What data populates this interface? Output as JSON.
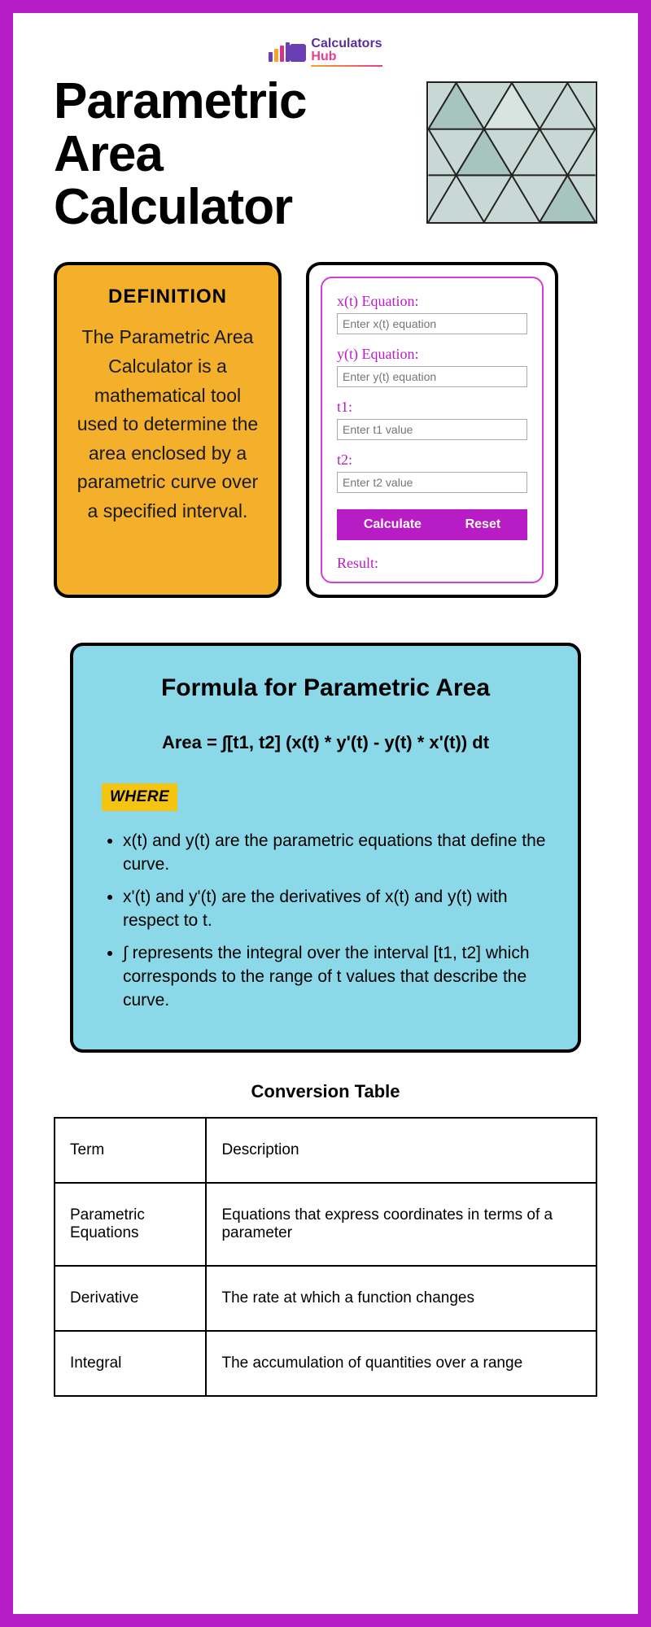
{
  "logo": {
    "line1": "Calculators",
    "line2": "Hub"
  },
  "title": "Parametric\nArea\nCalculator",
  "definition": {
    "heading": "DEFINITION",
    "body": "The Parametric Area Calculator is a mathematical tool used to determine the area enclosed by a parametric curve over a specified interval."
  },
  "calculator": {
    "xt_label": "x(t) Equation:",
    "xt_placeholder": "Enter x(t) equation",
    "yt_label": "y(t) Equation:",
    "yt_placeholder": "Enter y(t) equation",
    "t1_label": "t1:",
    "t1_placeholder": "Enter t1 value",
    "t2_label": "t2:",
    "t2_placeholder": "Enter t2 value",
    "calculate": "Calculate",
    "reset": "Reset",
    "result_label": "Result:"
  },
  "formula": {
    "heading": "Formula for Parametric Area",
    "expression": "Area = ∫[t1, t2] (x(t) * y'(t) - y(t) * x'(t)) dt",
    "where_tag": "WHERE",
    "bullets": [
      "x(t) and y(t) are the parametric equations that define the curve.",
      "x'(t) and y'(t) are the derivatives of x(t) and y(t) with respect to t.",
      "∫ represents the integral over the interval [t1, t2] which corresponds to the range of t values that describe the curve."
    ]
  },
  "table": {
    "heading": "Conversion Table",
    "rows": [
      {
        "term": "Term",
        "desc": "Description"
      },
      {
        "term": "Parametric Equations",
        "desc": "Equations that express coordinates in terms of a parameter"
      },
      {
        "term": "Derivative",
        "desc": "The rate at which a function changes"
      },
      {
        "term": "Integral",
        "desc": "The accumulation of quantities over a range"
      }
    ]
  }
}
